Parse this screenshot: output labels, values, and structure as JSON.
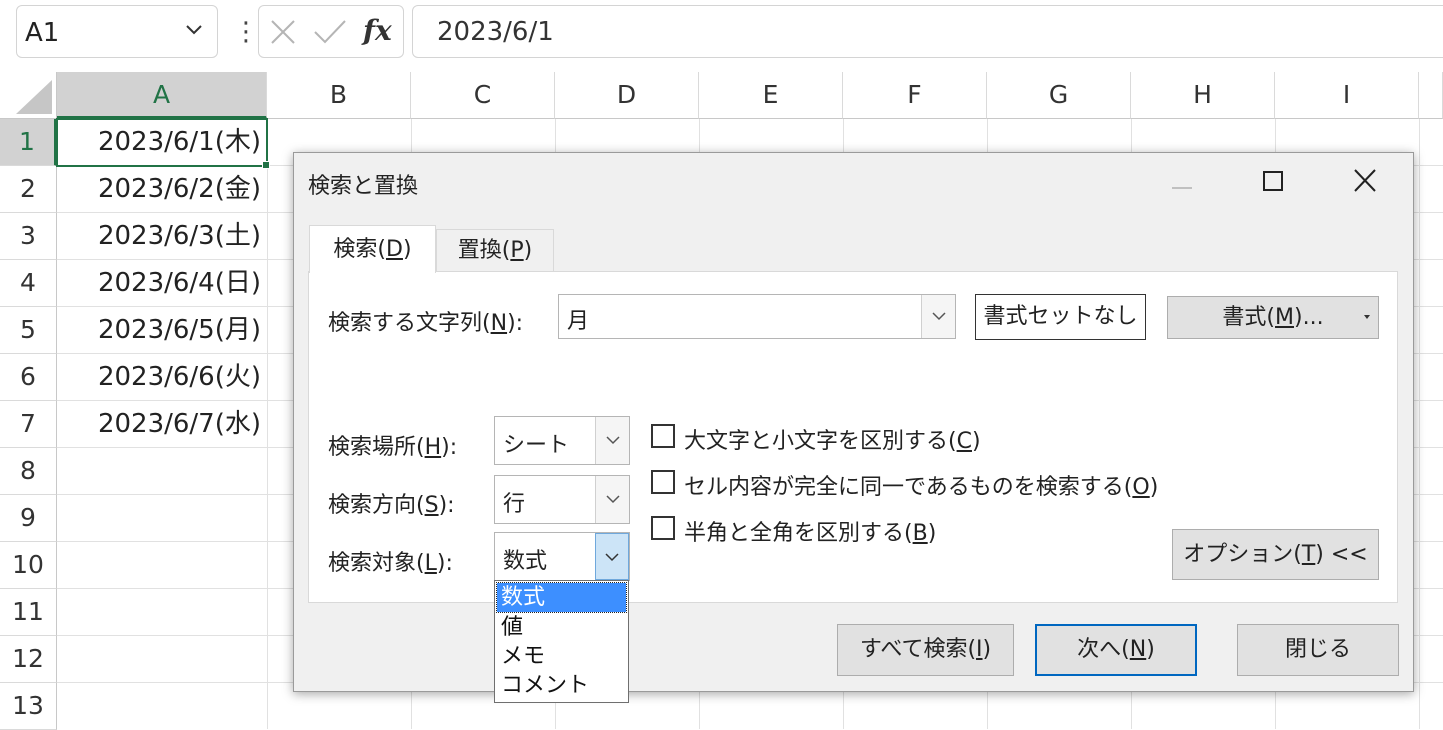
{
  "name_box": "A1",
  "formula_bar": {
    "value": "2023/6/1",
    "fx_label": "fx",
    "cancel_icon": "close-icon",
    "enter_icon": "checkmark-icon"
  },
  "columns": [
    "A",
    "B",
    "C",
    "D",
    "E",
    "F",
    "G",
    "H",
    "I"
  ],
  "rows": [
    "1",
    "2",
    "3",
    "4",
    "5",
    "6",
    "7",
    "8",
    "9",
    "10",
    "11",
    "12",
    "13"
  ],
  "cells": [
    "2023/6/1(木)",
    "2023/6/2(金)",
    "2023/6/3(土)",
    "2023/6/4(日)",
    "2023/6/5(月)",
    "2023/6/6(火)",
    "2023/6/7(水)"
  ],
  "dialog": {
    "title": "検索と置換",
    "tabs": [
      {
        "label": "検索(",
        "key": "D",
        "close": ")"
      },
      {
        "label": "置換(",
        "key": "P",
        "close": ")"
      }
    ],
    "find_label": {
      "pre": "検索する文字列(",
      "key": "N",
      "post": "):"
    },
    "find_value": "月",
    "no_format_button": "書式セットなし",
    "format_button": {
      "pre": "書式(",
      "key": "M",
      "post": ")..."
    },
    "within_label": {
      "pre": "検索場所(",
      "key": "H",
      "post": "):"
    },
    "within_value": "シート",
    "search_label": {
      "pre": "検索方向(",
      "key": "S",
      "post": "):"
    },
    "search_value": "行",
    "lookin_label": {
      "pre": "検索対象(",
      "key": "L",
      "post": "):"
    },
    "lookin_value": "数式",
    "lookin_options": [
      "数式",
      "値",
      "メモ",
      "コメント"
    ],
    "checkboxes": [
      {
        "pre": "大文字と小文字を区別する(",
        "key": "C",
        "post": ")"
      },
      {
        "pre": "セル内容が完全に同一であるものを検索する(",
        "key": "O",
        "post": ")"
      },
      {
        "pre": "半角と全角を区別する(",
        "key": "B",
        "post": ")"
      }
    ],
    "options_button": {
      "pre": "オプション(",
      "key": "T",
      "post": ") <<"
    },
    "find_all_button": {
      "pre": "すべて検索(",
      "key": "I",
      "post": ")"
    },
    "find_next_button": {
      "pre": "次へ(",
      "key": "N",
      "post": ")"
    },
    "close_button": "閉じる"
  }
}
